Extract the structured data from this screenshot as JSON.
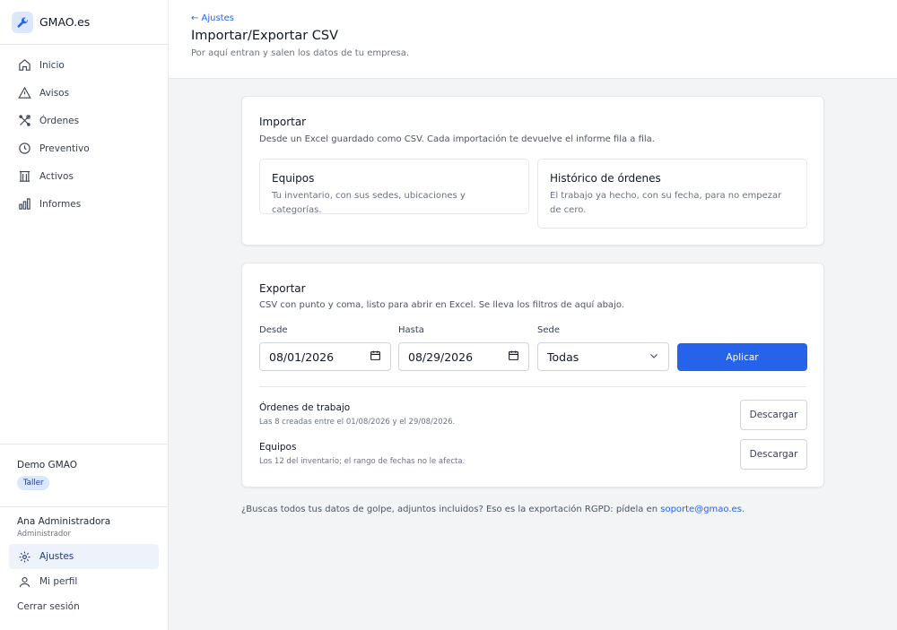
{
  "app": {
    "name": "GMAO.es"
  },
  "nav": [
    {
      "label": "Inicio",
      "icon": "home-icon"
    },
    {
      "label": "Avisos",
      "icon": "warning-icon"
    },
    {
      "label": "Órdenes",
      "icon": "tools-icon"
    },
    {
      "label": "Preventivo",
      "icon": "clock-icon"
    },
    {
      "label": "Activos",
      "icon": "building-icon"
    },
    {
      "label": "Informes",
      "icon": "bar-chart-icon"
    }
  ],
  "org": {
    "name": "Demo GMAO",
    "badge": "Taller"
  },
  "user": {
    "name": "Ana Administradora",
    "role": "Administrador",
    "settings_label": "Ajustes",
    "profile_label": "Mi perfil",
    "logout_label": "Cerrar sesión"
  },
  "header": {
    "back_label": "← Ajustes",
    "title": "Importar/Exportar CSV",
    "subtitle": "Por aquí entran y salen los datos de tu empresa."
  },
  "import": {
    "title": "Importar",
    "description": "Desde un Excel guardado como CSV. Cada importación te devuelve el informe fila a fila.",
    "options": [
      {
        "title": "Equipos",
        "description": "Tu inventario, con sus sedes, ubicaciones y categorías."
      },
      {
        "title": "Histórico de órdenes",
        "description": "El trabajo ya hecho, con su fecha, para no empezar de cero."
      }
    ]
  },
  "export": {
    "title": "Exportar",
    "description": "CSV con punto y coma, listo para abrir en Excel. Se lleva los filtros de aquí abajo.",
    "from_label": "Desde",
    "from_value": "08/01/2026",
    "to_label": "Hasta",
    "to_value": "08/29/2026",
    "site_label": "Sede",
    "site_value": "Todas",
    "apply_label": "Aplicar",
    "rows": [
      {
        "title": "Órdenes de trabajo",
        "subtitle": "Las 8 creadas entre el 01/08/2026 y el 29/08/2026.",
        "button": "Descargar"
      },
      {
        "title": "Equipos",
        "subtitle": "Los 12 del inventario; el rango de fechas no le afecta.",
        "button": "Descargar"
      }
    ]
  },
  "footnote": {
    "text": "¿Buscas todos tus datos de golpe, adjuntos incluidos? Eso es la exportación RGPD: pídela en ",
    "email": "soporte@gmao.es",
    "suffix": "."
  },
  "colors": {
    "accent": "#2563eb",
    "badge_bg": "#dbe7fb",
    "active_bg": "#eef2fb"
  }
}
